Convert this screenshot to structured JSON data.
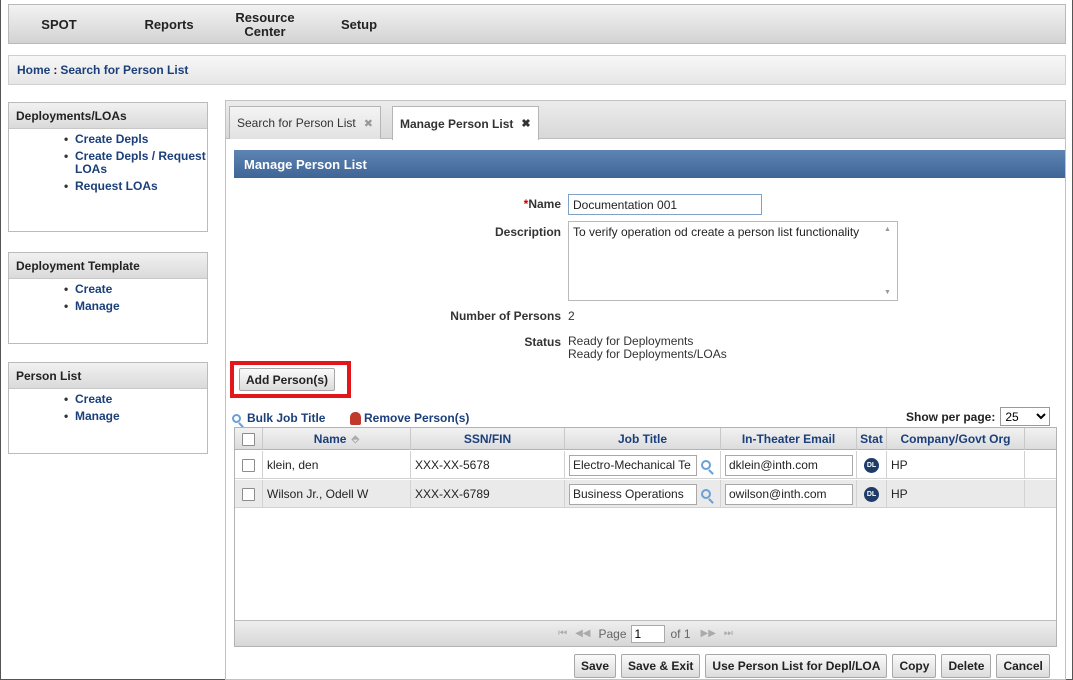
{
  "nav": {
    "items": [
      "SPOT",
      "Reports",
      "Resource Center",
      "Setup"
    ]
  },
  "breadcrumb": {
    "home": "Home",
    "separator": ":",
    "current": "Search for Person List"
  },
  "sidebar": {
    "deployments": {
      "title": "Deployments/LOAs",
      "items": [
        "Create Depls",
        "Create Depls / Request LOAs",
        "Request LOAs"
      ]
    },
    "template": {
      "title": "Deployment Template",
      "items": [
        "Create",
        "Manage"
      ]
    },
    "person_list": {
      "title": "Person List",
      "items": [
        "Create",
        "Manage"
      ]
    }
  },
  "tabs": [
    {
      "label": "Search for Person List",
      "close": "✖"
    },
    {
      "label": "Manage Person List",
      "close": "✖"
    }
  ],
  "section_title": "Manage Person List",
  "form": {
    "required_mark": "*",
    "name_label": "Name",
    "name_value": "Documentation 001",
    "description_label": "Description",
    "description_value": "To verify operation od create a person list functionality",
    "number_label": "Number of Persons",
    "number_value": "2",
    "status_label": "Status",
    "status_lines": [
      "Ready for Deployments",
      "Ready for Deployments/LOAs"
    ]
  },
  "buttons": {
    "add_person": "Add Person(s)",
    "bulk_job_title": "Bulk Job Title",
    "remove_person": "Remove Person(s)",
    "footer": [
      "Save",
      "Save & Exit",
      "Use Person List for Depl/LOA",
      "Copy",
      "Delete",
      "Cancel"
    ]
  },
  "show_per_page": {
    "label": "Show per page:",
    "value": "25"
  },
  "grid": {
    "columns": [
      "Name",
      "SSN/FIN",
      "Job Title",
      "In-Theater Email",
      "Stat",
      "Company/Govt Org"
    ],
    "sort_glyph": "⬘",
    "rows": [
      {
        "name": "klein, den",
        "ssn": "XXX-XX-5678",
        "job_title": "Electro-Mechanical Te",
        "email": "dklein@inth.com",
        "stat": "DL",
        "org": "HP"
      },
      {
        "name": "Wilson Jr., Odell W",
        "ssn": "XXX-XX-6789",
        "job_title": "Business Operations",
        "email": "owilson@inth.com",
        "stat": "DL",
        "org": "HP"
      }
    ]
  },
  "pager": {
    "page_label": "Page",
    "page_value": "1",
    "of_label": "of 1",
    "first": "⏮",
    "prev": "◀◀",
    "next": "▶▶",
    "last": "⏭"
  }
}
